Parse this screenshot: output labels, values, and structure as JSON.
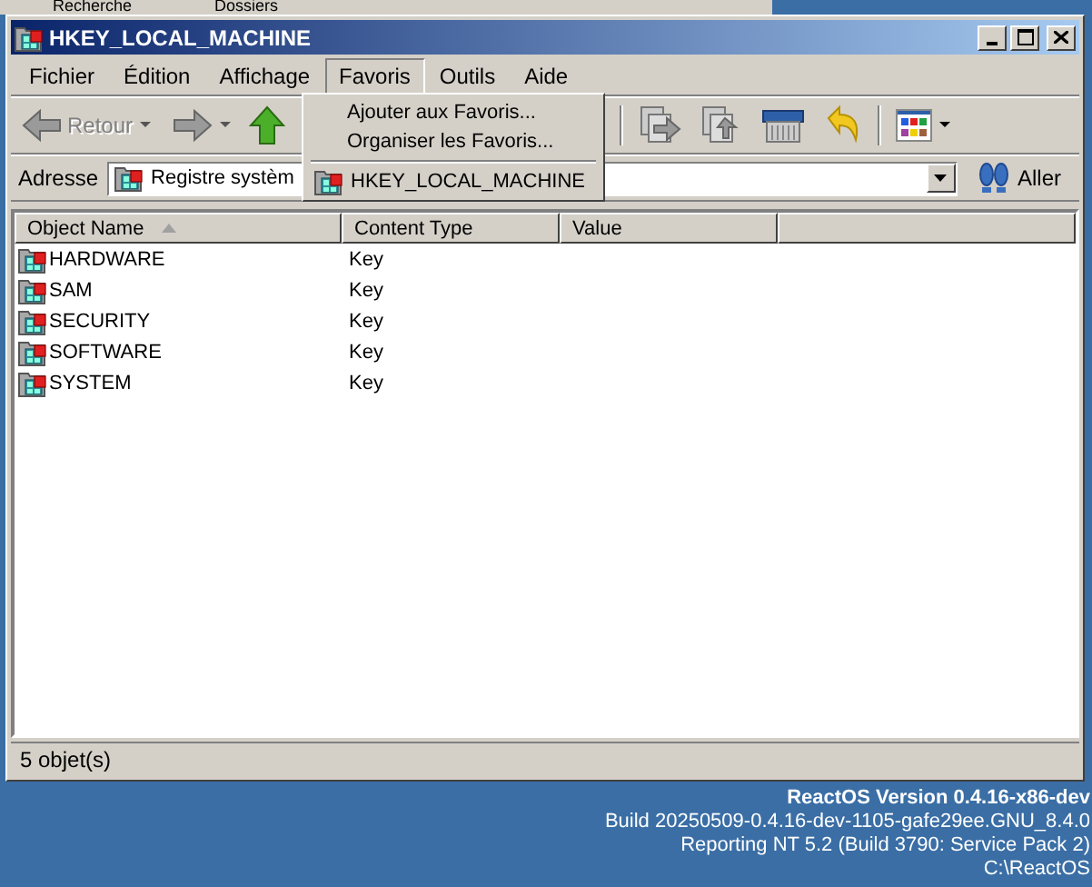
{
  "background_window": {
    "toolbar": [
      "Recherche",
      "Dossiers"
    ]
  },
  "window": {
    "title": "HKEY_LOCAL_MACHINE"
  },
  "menu_bar": [
    {
      "label": "Fichier",
      "selected": false
    },
    {
      "label": "Édition",
      "selected": false
    },
    {
      "label": "Affichage",
      "selected": false
    },
    {
      "label": "Favoris",
      "selected": true
    },
    {
      "label": "Outils",
      "selected": false
    },
    {
      "label": "Aide",
      "selected": false
    }
  ],
  "toolbar": {
    "back": {
      "label": "Retour",
      "disabled": true
    }
  },
  "address_bar": {
    "label": "Adresse",
    "value": "Registre systèm",
    "go_button": "Aller"
  },
  "list": {
    "columns": [
      {
        "label": "Object Name",
        "sorted": true
      },
      {
        "label": "Content Type",
        "sorted": false
      },
      {
        "label": "Value",
        "sorted": false
      }
    ],
    "rows": [
      {
        "name": "HARDWARE",
        "type": "Key"
      },
      {
        "name": "SAM",
        "type": "Key"
      },
      {
        "name": "SECURITY",
        "type": "Key"
      },
      {
        "name": "SOFTWARE",
        "type": "Key"
      },
      {
        "name": "SYSTEM",
        "type": "Key"
      }
    ]
  },
  "status_bar": "5 objet(s)",
  "favorites_menu": [
    {
      "kind": "command",
      "label": "Ajouter aux Favoris..."
    },
    {
      "kind": "command",
      "label": "Organiser les Favoris..."
    },
    {
      "kind": "separator"
    },
    {
      "kind": "favorite",
      "label": "HKEY_LOCAL_MACHINE"
    }
  ],
  "desktop_info": [
    {
      "text": "ReactOS Version 0.4.16-x86-dev",
      "bold": true
    },
    {
      "text": "Build 20250509-0.4.16-dev-1105-gafe29ee.GNU_8.4.0",
      "bold": false
    },
    {
      "text": "Reporting NT 5.2 (Build 3790: Service Pack 2)",
      "bold": false
    },
    {
      "text": "C:\\ReactOS",
      "bold": false
    }
  ]
}
